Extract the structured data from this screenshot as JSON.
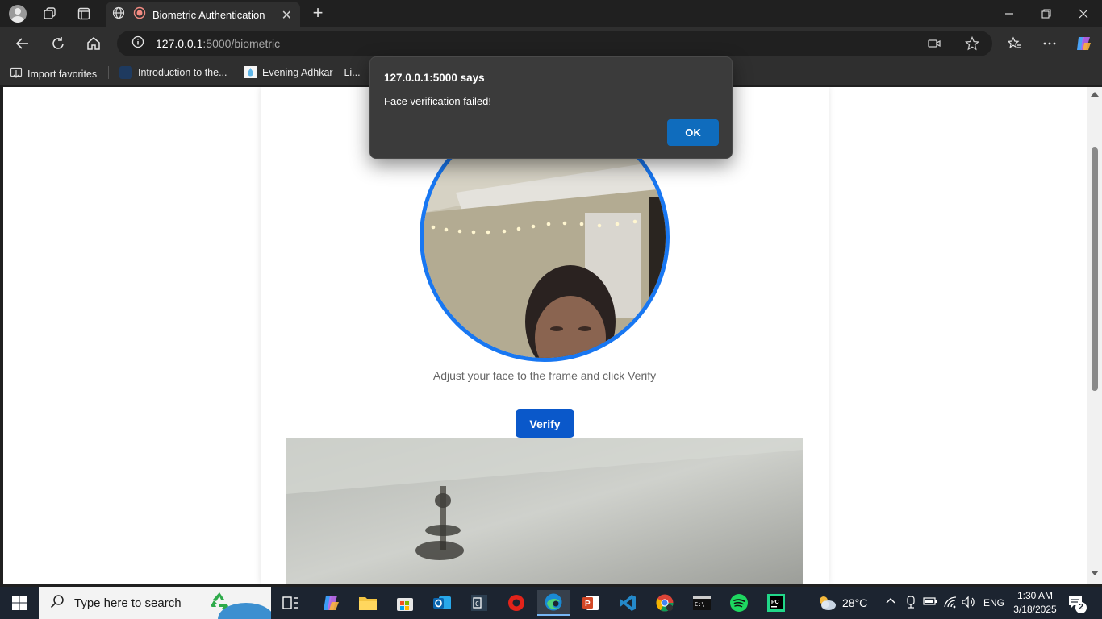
{
  "browser": {
    "tab_title": "Biometric Authentication",
    "url_host": "127.0.0.1",
    "url_rest": ":5000/biometric",
    "bookmarks": [
      "Import favorites",
      "Introduction to the...",
      "Evening Adhkar – Li..."
    ]
  },
  "page": {
    "instruction": "Adjust your face to the frame and click Verify",
    "verify_label": "Verify",
    "accent_color": "#1877f2",
    "button_color": "#0a58ca"
  },
  "dialog": {
    "title": "127.0.0.1:5000 says",
    "message": "Face verification failed!",
    "ok_label": "OK"
  },
  "taskbar": {
    "search_placeholder": "Type here to search",
    "weather": "28°C",
    "language": "ENG",
    "time": "1:30 AM",
    "date": "3/18/2025",
    "notification_count": "2"
  }
}
